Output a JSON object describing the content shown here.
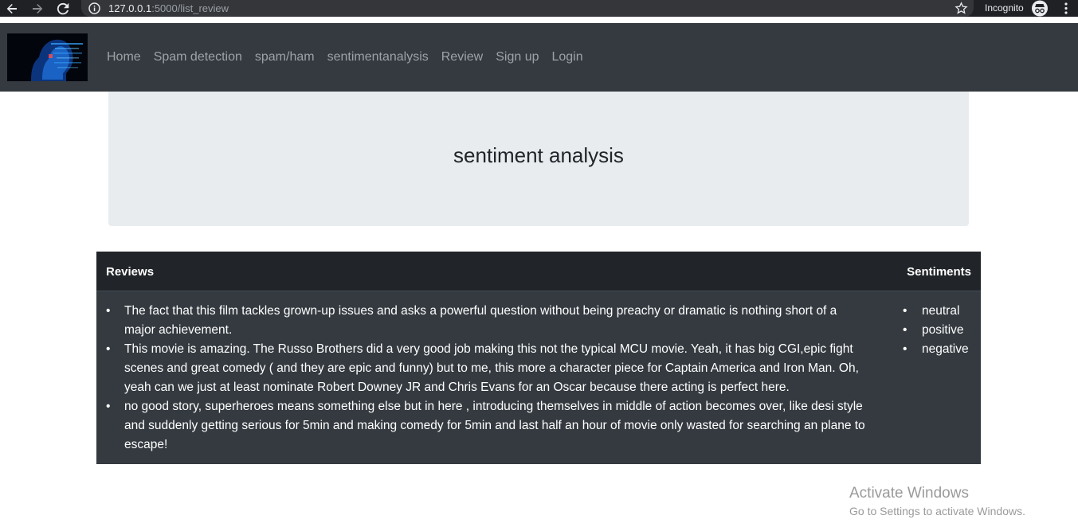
{
  "browser": {
    "url_host": "127.0.0.1",
    "url_rest": ":5000/list_review",
    "incognito_label": "Incognito",
    "icons": [
      "back-icon",
      "forward-icon",
      "reload-icon",
      "info-icon",
      "star-icon",
      "incognito-icon",
      "menu-icon"
    ]
  },
  "navbar": {
    "links": [
      "Home",
      "Spam detection",
      "spam/ham",
      "sentimentanalysis",
      "Review",
      "Sign up",
      "Login"
    ]
  },
  "jumbotron": {
    "title": "sentiment analysis"
  },
  "table": {
    "headers": {
      "reviews": "Reviews",
      "sentiments": "Sentiments"
    },
    "reviews": [
      "The fact that this film tackles grown-up issues and asks a powerful question without being preachy or dramatic is nothing short of a major achievement.",
      "This movie is amazing. The Russo Brothers did a very good job making this not the typical MCU movie. Yeah, it has big CGI,epic fight scenes and great comedy ( and they are epic and funny) but to me, this more a character piece for Captain America and Iron Man. Oh, yeah can we just at least nominate Robert Downey JR and Chris Evans for an Oscar because there acting is perfect here.",
      "no good story, superheroes means something else but in here , introducing themselves in middle of action becomes over, like desi style and suddenly getting serious for 5min and making comedy for 5min and last half an hour of movie only wasted for searching an plane to escape!"
    ],
    "sentiments": [
      "neutral",
      "positive",
      "negative"
    ]
  },
  "watermark": {
    "title": "Activate Windows",
    "subtitle": "Go to Settings to activate Windows."
  },
  "colors": {
    "browser_bg": "#202124",
    "navbar_bg": "#343a40",
    "table_head_bg": "#212529",
    "jumbotron_bg": "#e9ecef"
  }
}
